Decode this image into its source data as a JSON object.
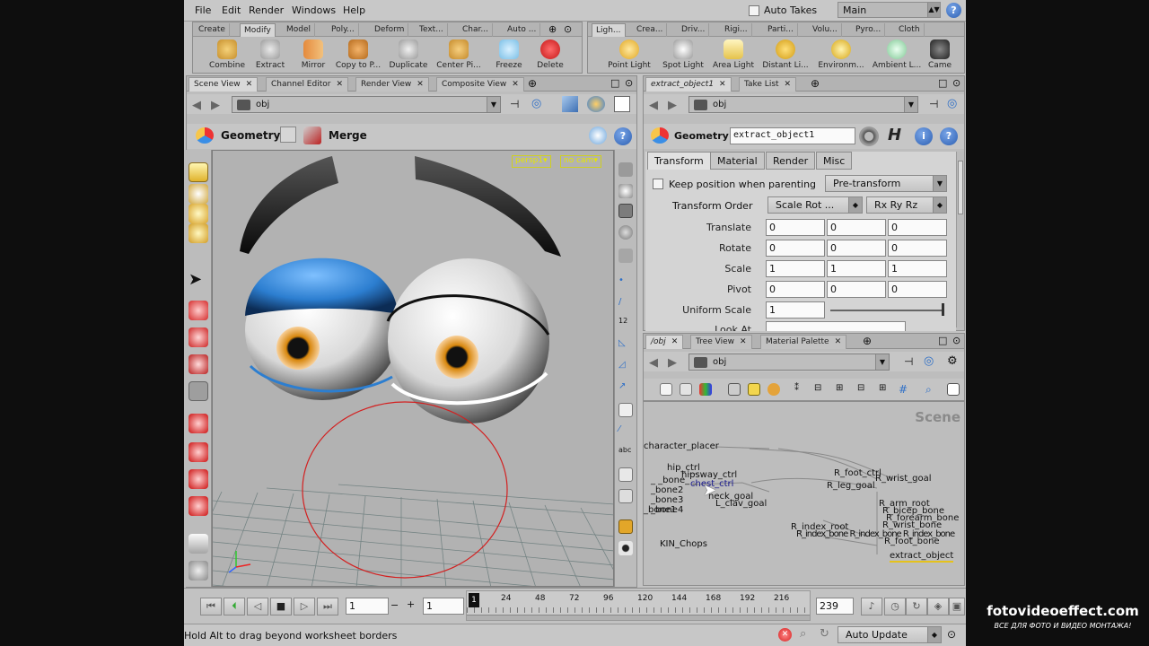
{
  "menu": {
    "file": "File",
    "edit": "Edit",
    "render": "Render",
    "windows": "Windows",
    "help": "Help"
  },
  "auto_takes": "Auto Takes",
  "desktop": "Main",
  "shelf_left": {
    "tabs": [
      "Create",
      "Modify",
      "Model",
      "Poly...",
      "Deform",
      "Text...",
      "Char...",
      "Auto ..."
    ],
    "active_tab": "Modify",
    "tools": [
      "Combine",
      "Extract",
      "Mirror",
      "Copy to P...",
      "Duplicate",
      "Center Pi...",
      "Freeze",
      "Delete"
    ]
  },
  "shelf_right": {
    "tabs": [
      "Ligh...",
      "Crea...",
      "Driv...",
      "Rigi...",
      "Parti...",
      "Volu...",
      "Pyro...",
      "Cloth"
    ],
    "active_tab": "Ligh...",
    "tools": [
      "Point Light",
      "Spot Light",
      "Area Light",
      "Distant Li...",
      "Environm...",
      "Ambient L...",
      "Came"
    ]
  },
  "left_pane": {
    "tabs": [
      "Scene View",
      "Channel Editor",
      "Render View",
      "Composite View"
    ],
    "path": "obj",
    "context": "Geometry",
    "merge": "Merge",
    "cam_labels": {
      "persp": "persp1",
      "cam": "no cam"
    }
  },
  "param_pane": {
    "tabs": [
      "extract_object1",
      "Take List"
    ],
    "path": "obj",
    "type": "Geometry",
    "node_name": "extract_object1",
    "subtabs": [
      "Transform",
      "Material",
      "Render",
      "Misc"
    ],
    "keep_position": "Keep position when parenting",
    "pre_transform": "Pre-transform",
    "transform_order_label": "Transform Order",
    "transform_order": "Scale Rot ...",
    "rot_order": "Rx Ry Rz",
    "rows": [
      {
        "label": "Translate",
        "values": [
          "0",
          "0",
          "0"
        ]
      },
      {
        "label": "Rotate",
        "values": [
          "0",
          "0",
          "0"
        ]
      },
      {
        "label": "Scale",
        "values": [
          "1",
          "1",
          "1"
        ]
      },
      {
        "label": "Pivot",
        "values": [
          "0",
          "0",
          "0"
        ]
      }
    ],
    "uniform_scale_label": "Uniform Scale",
    "uniform_scale": "1",
    "look_at_label": "Look At"
  },
  "network_pane": {
    "tabs": [
      "/obj",
      "Tree View",
      "Material Palette"
    ],
    "path": "obj",
    "scene_label": "Scene",
    "nodes": {
      "character_placer": "character_placer",
      "hip_ctrl": "hip_ctrl",
      "sway_ctrl": "hipsway_ctrl",
      "chest_ctrl": "chest_ctrl",
      "neck_goal": "neck_goal",
      "clav_goal": "L_clav_goal",
      "bone1": "_bone1",
      "r_foot_ctrl": "R_foot_ctrl",
      "wrist_goal": "R_wrist_goal",
      "goal2": "R_leg_goal",
      "arm_root": "R_arm_root",
      "bicep_bone": "R_bicep_bone",
      "forearm_bone": "R_forearm_bone",
      "wrist_bone": "R_wrist_bone",
      "index_root": "R_index_root",
      "foot_bone": "R_foot_bone",
      "chops": "KIN_Chops",
      "extract": "extract_object"
    }
  },
  "timeline": {
    "frame": "1",
    "start": "1",
    "end": "239",
    "ticks": [
      "1",
      "24",
      "48",
      "72",
      "96",
      "120",
      "144",
      "168",
      "192",
      "216"
    ]
  },
  "status": {
    "message": "Hold Alt to drag beyond worksheet borders",
    "update_mode": "Auto Update"
  },
  "watermark": {
    "title": "fotovideoeffect.com",
    "subtitle": "ВСЕ ДЛЯ ФОТО И ВИДЕО МОНТАЖА!"
  }
}
